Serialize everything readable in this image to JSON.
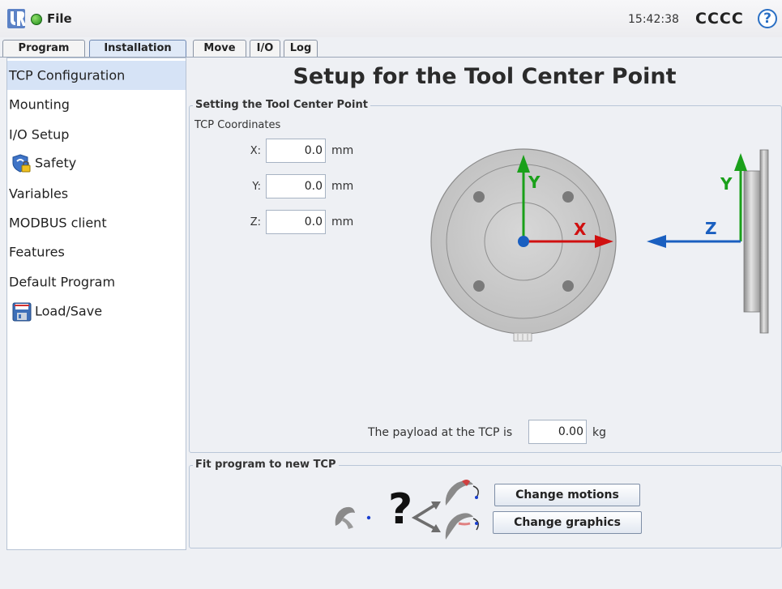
{
  "topbar": {
    "file_menu": "File",
    "clock": "15:42:38",
    "robot_name": "CCCC",
    "help_glyph": "?",
    "status_color": "#2aa01f"
  },
  "tabs": [
    {
      "label": "Program",
      "active": false
    },
    {
      "label": "Installation",
      "active": true
    },
    {
      "label": "Move",
      "active": false
    },
    {
      "label": "I/O",
      "active": false
    },
    {
      "label": "Log",
      "active": false
    }
  ],
  "sidebar": {
    "items": [
      {
        "label": "TCP Configuration",
        "active": true
      },
      {
        "label": "Mounting"
      },
      {
        "label": "I/O Setup"
      },
      {
        "label": "Safety",
        "icon": "shield-lock-icon"
      },
      {
        "label": "Variables"
      },
      {
        "label": "MODBUS client"
      },
      {
        "label": "Features"
      },
      {
        "label": "Default Program"
      },
      {
        "label": "Load/Save",
        "icon": "floppy-disk-icon"
      }
    ]
  },
  "main": {
    "title": "Setup for the Tool Center Point",
    "tcp_group": {
      "title": "Setting the Tool Center Point",
      "coords_label": "TCP Coordinates",
      "x_label": "X:",
      "x_value": "0.0",
      "y_label": "Y:",
      "y_value": "0.0",
      "z_label": "Z:",
      "z_value": "0.0",
      "unit": "mm",
      "payload_label": "The payload at the TCP is",
      "payload_value": "0.00",
      "payload_unit": "kg"
    },
    "diagram": {
      "front_x": "X",
      "front_y": "Y",
      "side_y": "Y",
      "side_z": "Z",
      "x_color": "#d01010",
      "y_color": "#1aa01a",
      "z_color": "#1a5fc0"
    },
    "fit_group": {
      "title": "Fit program to new TCP",
      "question_glyph": "?",
      "change_motions": "Change motions",
      "change_graphics": "Change graphics"
    }
  }
}
